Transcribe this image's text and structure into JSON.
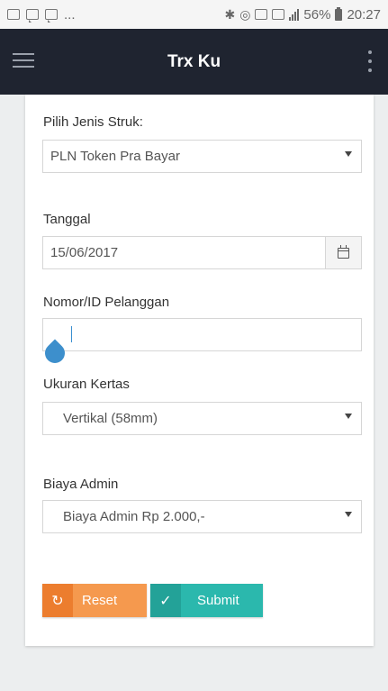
{
  "status_bar": {
    "dots": "...",
    "signal_label": "56%",
    "time": "20:27"
  },
  "app_bar": {
    "title": "Trx Ku"
  },
  "form": {
    "receipt_type": {
      "label": "Pilih Jenis Struk:",
      "value": "PLN Token Pra Bayar"
    },
    "date": {
      "label": "Tanggal",
      "value": "15/06/2017"
    },
    "customer_id": {
      "label": "Nomor/ID Pelanggan",
      "value": ""
    },
    "paper_size": {
      "label": "Ukuran Kertas",
      "value": "Vertikal (58mm)"
    },
    "admin_fee": {
      "label": "Biaya Admin",
      "value": "Biaya Admin Rp 2.000,-"
    }
  },
  "buttons": {
    "reset_label": "Reset",
    "submit_label": "Submit"
  },
  "colors": {
    "app_bar": "#1f2430",
    "reset": "#f5994e",
    "submit": "#2bb8ad"
  }
}
